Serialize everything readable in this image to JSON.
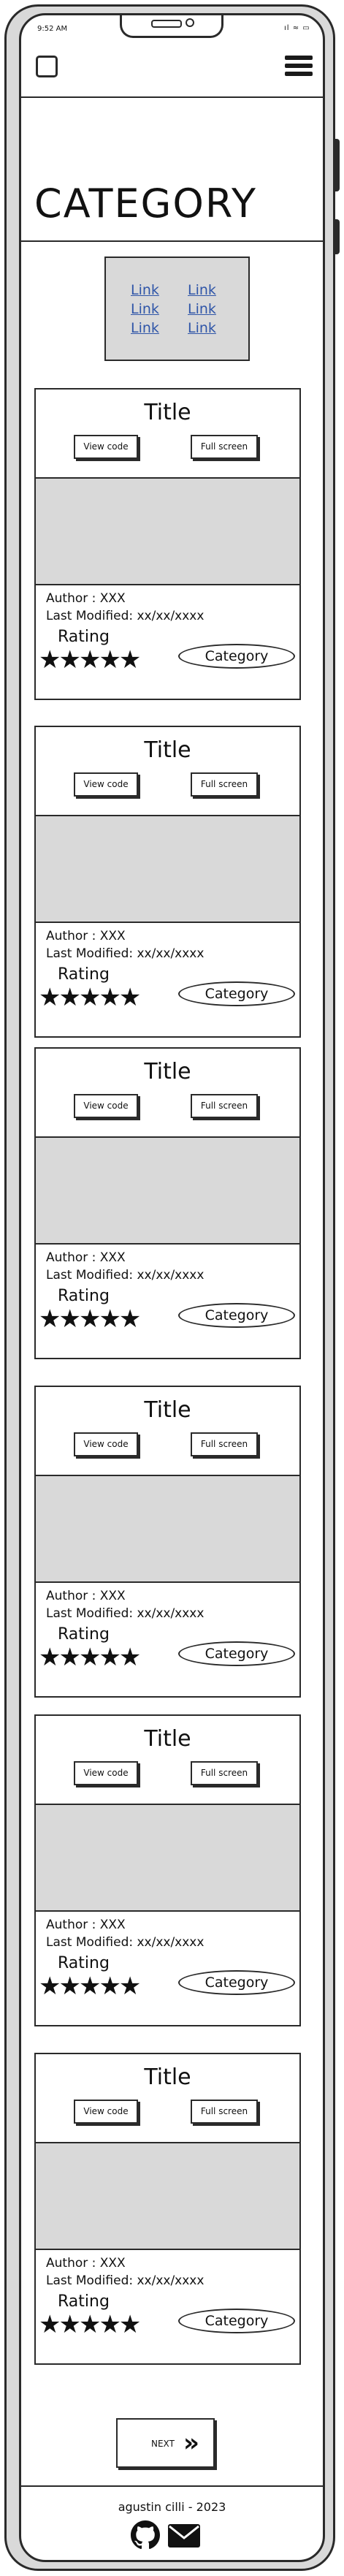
{
  "status_bar": {
    "time": "9:52 AM",
    "icons": "ıl ≈ ▭"
  },
  "header": {
    "title": "CATEGORY"
  },
  "links": [
    "Link",
    "Link",
    "Link",
    "Link",
    "Link",
    "Link"
  ],
  "cards": [
    {
      "title": "Title",
      "view_code": "View code",
      "full_screen": "Full screen",
      "author": "Author : XXX",
      "modified": "Last Modified: xx/xx/xxxx",
      "rating_label": "Rating",
      "stars": "★★★★★",
      "category": "Category"
    },
    {
      "title": "Title",
      "view_code": "View code",
      "full_screen": "Full screen",
      "author": "Author : XXX",
      "modified": "Last Modified: xx/xx/xxxx",
      "rating_label": "Rating",
      "stars": "★★★★★",
      "category": "Category"
    },
    {
      "title": "Title",
      "view_code": "View code",
      "full_screen": "Full screen",
      "author": "Author : XXX",
      "modified": "Last Modified: xx/xx/xxxx",
      "rating_label": "Rating",
      "stars": "★★★★★",
      "category": "Category"
    },
    {
      "title": "Title",
      "view_code": "View code",
      "full_screen": "Full screen",
      "author": "Author : XXX",
      "modified": "Last Modified: xx/xx/xxxx",
      "rating_label": "Rating",
      "stars": "★★★★★",
      "category": "Category"
    },
    {
      "title": "Title",
      "view_code": "View code",
      "full_screen": "Full screen",
      "author": "Author : XXX",
      "modified": "Last Modified: xx/xx/xxxx",
      "rating_label": "Rating",
      "stars": "★★★★★",
      "category": "Category"
    },
    {
      "title": "Title",
      "view_code": "View code",
      "full_screen": "Full screen",
      "author": "Author : XXX",
      "modified": "Last Modified: xx/xx/xxxx",
      "rating_label": "Rating",
      "stars": "★★★★★",
      "category": "Category"
    }
  ],
  "pagination": {
    "next_label": "NEXT",
    "next_icon": "»"
  },
  "footer": {
    "credit": "agustin cilli - 2023",
    "icons": [
      "github-icon",
      "mail-icon"
    ]
  },
  "colors": {
    "link": "#2f55a8",
    "placeholder": "#d9d9d9",
    "outline": "#2a2a2a"
  }
}
